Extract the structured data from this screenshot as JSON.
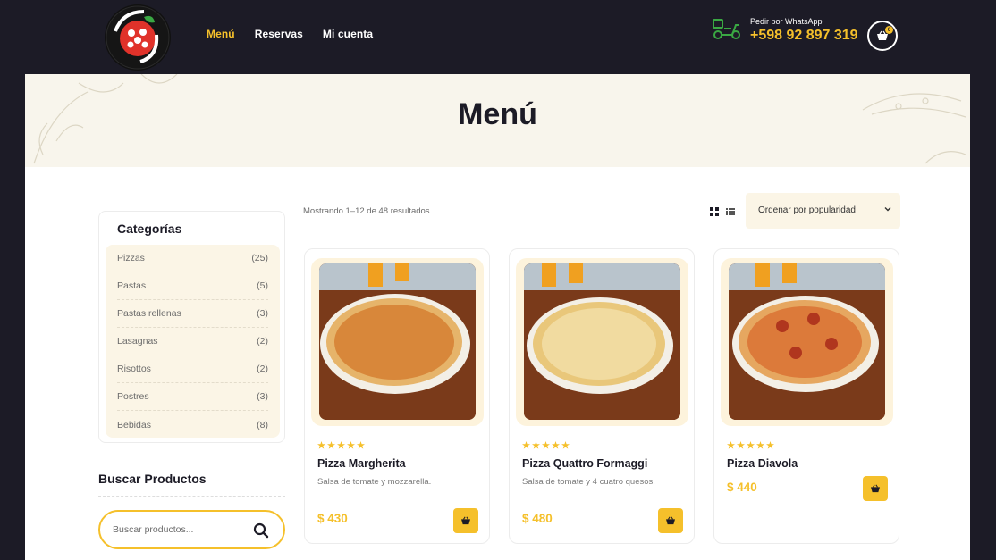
{
  "brand": {
    "logo_text_top": "IL TRANCIO",
    "logo_text_bottom": "D'ITALIA"
  },
  "nav": [
    {
      "label": "Menú",
      "active": true
    },
    {
      "label": "Reservas",
      "active": false
    },
    {
      "label": "Mi cuenta",
      "active": false
    }
  ],
  "whatsapp": {
    "label": "Pedir por WhatsApp",
    "phone": "+598 92 897 319",
    "icon": "scooter-icon"
  },
  "cart": {
    "count": "0",
    "icon": "basket-icon"
  },
  "hero": {
    "title": "Menú"
  },
  "categories": {
    "title": "Categorías",
    "items": [
      {
        "label": "Pizzas",
        "count": "(25)"
      },
      {
        "label": "Pastas",
        "count": "(5)"
      },
      {
        "label": "Pastas rellenas",
        "count": "(3)"
      },
      {
        "label": "Lasagnas",
        "count": "(2)"
      },
      {
        "label": "Risottos",
        "count": "(2)"
      },
      {
        "label": "Postres",
        "count": "(3)"
      },
      {
        "label": "Bebidas",
        "count": "(8)"
      }
    ]
  },
  "search": {
    "title": "Buscar Productos",
    "placeholder": "Buscar productos..."
  },
  "toolbar": {
    "results": "Mostrando 1–12 de 48 resultados",
    "sort_label": "Ordenar por popularidad"
  },
  "products": [
    {
      "name": "Pizza Margherita",
      "description": "Salsa de tomate y mozzarella.",
      "price": "$ 430",
      "rating": 5
    },
    {
      "name": "Pizza Quattro Formaggi",
      "description": "Salsa de tomate y 4 cuatro quesos.",
      "price": "$ 480",
      "rating": 5
    },
    {
      "name": "Pizza Diavola",
      "description": "",
      "price": "$ 440",
      "rating": 5
    }
  ],
  "colors": {
    "accent": "#f5c02b",
    "dark": "#1c1b26",
    "cream": "#fbf5e6"
  }
}
